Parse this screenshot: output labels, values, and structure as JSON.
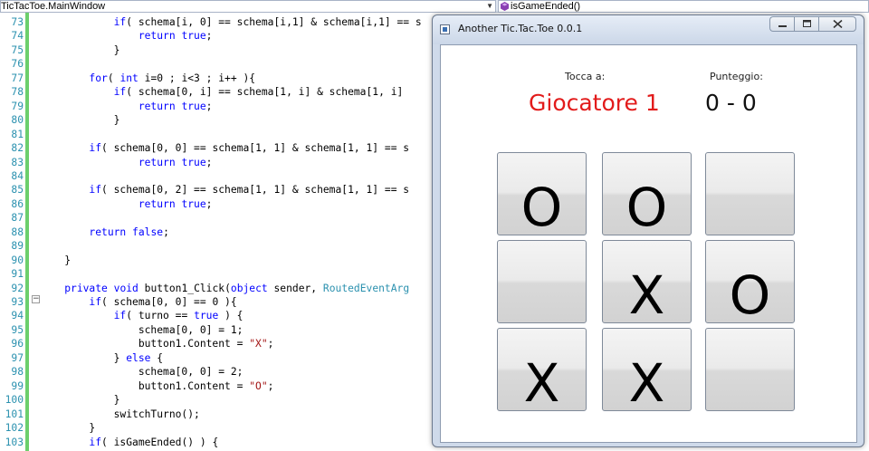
{
  "ide": {
    "class_combo": "TicTacToe.MainWindow",
    "member_combo": "isGameEnded()",
    "lines": [
      {
        "n": "73",
        "html": "            <span class=\"kw\">if</span>( schema[i, 0] == schema[i,1] &amp; schema[i,1] == s"
      },
      {
        "n": "74",
        "html": "                <span class=\"kw\">return</span> <span class=\"kw\">true</span>;"
      },
      {
        "n": "75",
        "html": "            }"
      },
      {
        "n": "76",
        "html": ""
      },
      {
        "n": "77",
        "html": "        <span class=\"kw\">for</span>( <span class=\"kw\">int</span> i=0 ; i&lt;3 ; i++ ){"
      },
      {
        "n": "78",
        "html": "            <span class=\"kw\">if</span>( schema[0, i] == schema[1, i] &amp; schema[1, i]"
      },
      {
        "n": "79",
        "html": "                <span class=\"kw\">return</span> <span class=\"kw\">true</span>;"
      },
      {
        "n": "80",
        "html": "            }"
      },
      {
        "n": "81",
        "html": ""
      },
      {
        "n": "82",
        "html": "        <span class=\"kw\">if</span>( schema[0, 0] == schema[1, 1] &amp; schema[1, 1] == s"
      },
      {
        "n": "83",
        "html": "                <span class=\"kw\">return</span> <span class=\"kw\">true</span>;"
      },
      {
        "n": "84",
        "html": ""
      },
      {
        "n": "85",
        "html": "        <span class=\"kw\">if</span>( schema[0, 2] == schema[1, 1] &amp; schema[1, 1] == s"
      },
      {
        "n": "86",
        "html": "                <span class=\"kw\">return</span> <span class=\"kw\">true</span>;"
      },
      {
        "n": "87",
        "html": ""
      },
      {
        "n": "88",
        "html": "        <span class=\"kw\">return</span> <span class=\"kw\">false</span>;"
      },
      {
        "n": "89",
        "html": ""
      },
      {
        "n": "90",
        "html": "    }"
      },
      {
        "n": "91",
        "html": ""
      },
      {
        "n": "92",
        "html": "    <span class=\"kw\">private</span> <span class=\"kw\">void</span> button1_Click(<span class=\"kw\">object</span> sender, <span class=\"typ\">RoutedEventArg</span>"
      },
      {
        "n": "93",
        "html": "        <span class=\"kw\">if</span>( schema[0, 0] == 0 ){"
      },
      {
        "n": "94",
        "html": "            <span class=\"kw\">if</span>( turno == <span class=\"kw\">true</span> ) {"
      },
      {
        "n": "95",
        "html": "                schema[0, 0] = 1;"
      },
      {
        "n": "96",
        "html": "                button1.Content = <span class=\"str\">\"X\"</span>;"
      },
      {
        "n": "97",
        "html": "            } <span class=\"kw\">else</span> {"
      },
      {
        "n": "98",
        "html": "                schema[0, 0] = 2;"
      },
      {
        "n": "99",
        "html": "                button1.Content = <span class=\"str\">\"O\"</span>;"
      },
      {
        "n": "100",
        "html": "            }"
      },
      {
        "n": "101",
        "html": "            switchTurno();"
      },
      {
        "n": "102",
        "html": "        }"
      },
      {
        "n": "103",
        "html": "        <span class=\"kw\">if</span>( isGameEnded() ) {"
      }
    ]
  },
  "app": {
    "title": "Another Tic.Tac.Toe 0.0.1",
    "turn_caption": "Tocca a:",
    "turn_value": "Giocatore 1",
    "score_caption": "Punteggio:",
    "score_value": "0 - 0",
    "board": [
      "O",
      "O",
      "",
      "",
      "X",
      "O",
      "X",
      "X",
      ""
    ],
    "colors": {
      "turn": "#e21b1b"
    }
  }
}
